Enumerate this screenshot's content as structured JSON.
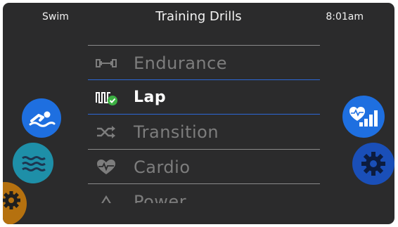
{
  "header": {
    "left": "Swim",
    "title": "Training Drills",
    "time": "8:01am"
  },
  "drills": [
    {
      "label": "Endurance",
      "icon": "dumbbell-icon",
      "selected": false
    },
    {
      "label": "Lap",
      "icon": "lap-wave-check-icon",
      "selected": true
    },
    {
      "label": "Transition",
      "icon": "shuffle-icon",
      "selected": false
    },
    {
      "label": "Cardio",
      "icon": "heartbeat-icon",
      "selected": false
    },
    {
      "label": "Power",
      "icon": "triangle-icon",
      "selected": false
    }
  ],
  "buttons": {
    "swim": {
      "icon": "swimmer-icon",
      "color": "#1e6fe0"
    },
    "water": {
      "icon": "water-waves-icon",
      "color": "#1e8fa8"
    },
    "settings_left": {
      "icon": "gear-icon",
      "color": "#b5710f"
    },
    "stats": {
      "icon": "heart-chart-icon",
      "color": "#1e6fe0"
    },
    "settings_right": {
      "icon": "gear-icon",
      "color": "#1a4fb8"
    }
  },
  "colors": {
    "background": "#2b2b2c",
    "accent": "#2d68d8",
    "inactive_text": "#7d7d7d",
    "check": "#3cb043"
  }
}
